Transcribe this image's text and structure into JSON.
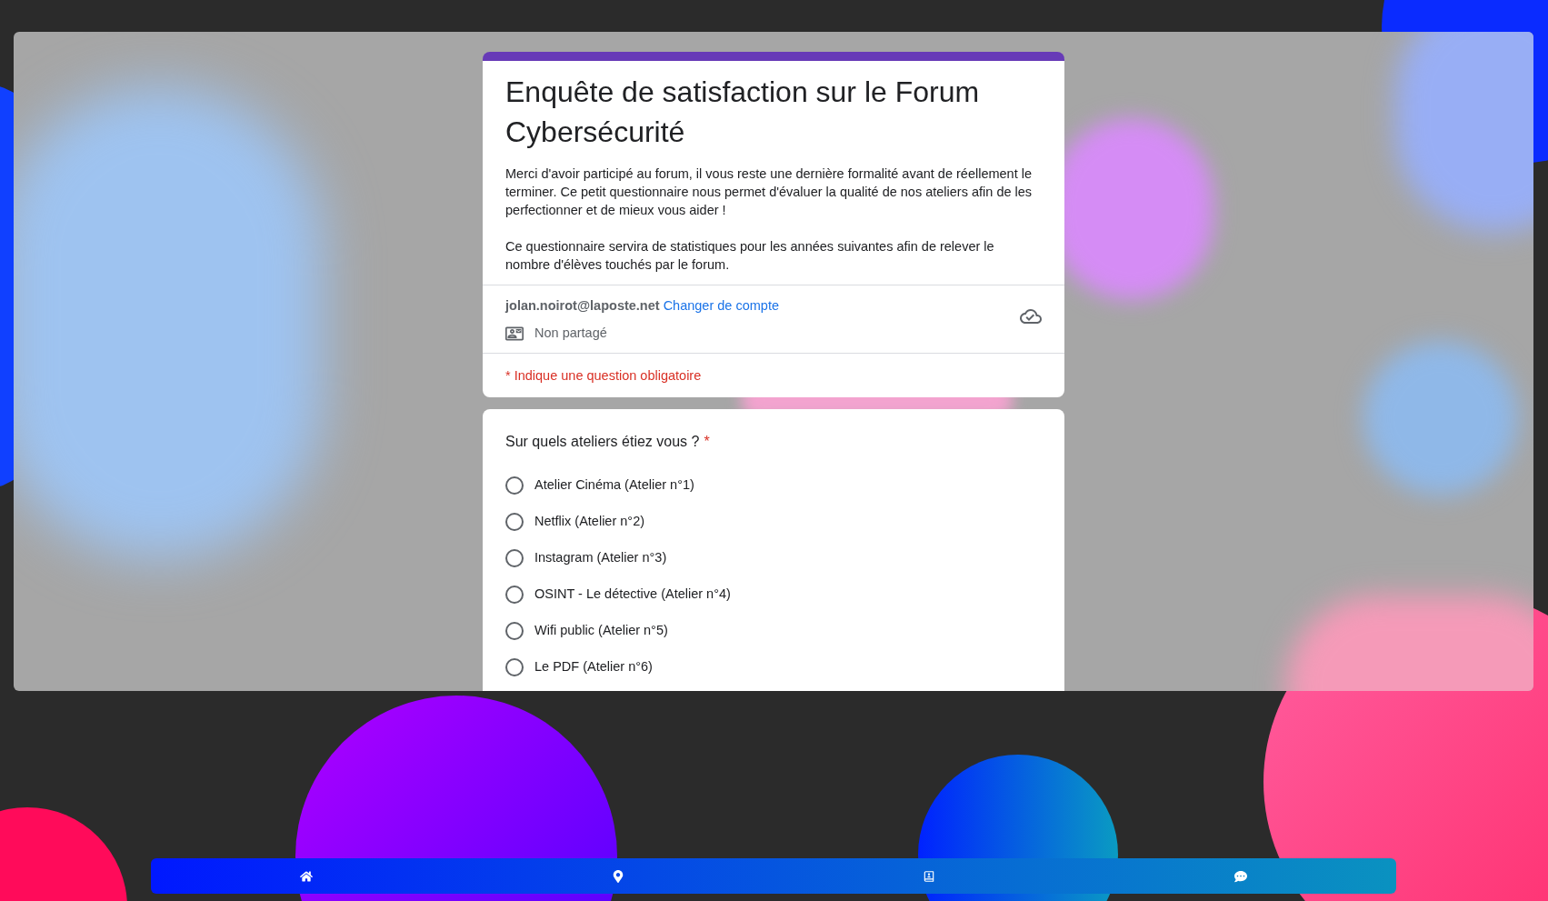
{
  "form": {
    "title": "Enquête de satisfaction sur le Forum Cybersécurité",
    "description": [
      "Merci d'avoir participé au forum, il vous reste une dernière formalité avant de réellement le terminer. Ce petit questionnaire nous permet d'évaluer la qualité de nos ateliers afin de les perfectionner et de mieux vous aider !",
      "Ce questionnaire servira de statistiques pour les années suivantes afin de relever le nombre d'élèves touchés par le forum."
    ],
    "account": {
      "email": "jolan.noirot@laposte.net",
      "switch_link": "Changer de compte",
      "sharing": "Non partagé"
    },
    "required_note": "* Indique une question obligatoire"
  },
  "question": {
    "label": "Sur quels ateliers étiez vous ?",
    "required_mark": "*",
    "options": [
      {
        "label": "Atelier Cinéma (Atelier n°1)",
        "selected": false
      },
      {
        "label": "Netflix (Atelier n°2)",
        "selected": false
      },
      {
        "label": "Instagram (Atelier n°3)",
        "selected": false
      },
      {
        "label": "OSINT - Le détective (Atelier n°4)",
        "selected": false
      },
      {
        "label": "Wifi public (Atelier n°5)",
        "selected": false
      },
      {
        "label": "Le PDF (Atelier n°6)",
        "selected": false
      }
    ]
  },
  "nav": [
    {
      "kind": "home"
    },
    {
      "kind": "location"
    },
    {
      "kind": "profile"
    },
    {
      "kind": "chat"
    }
  ]
}
